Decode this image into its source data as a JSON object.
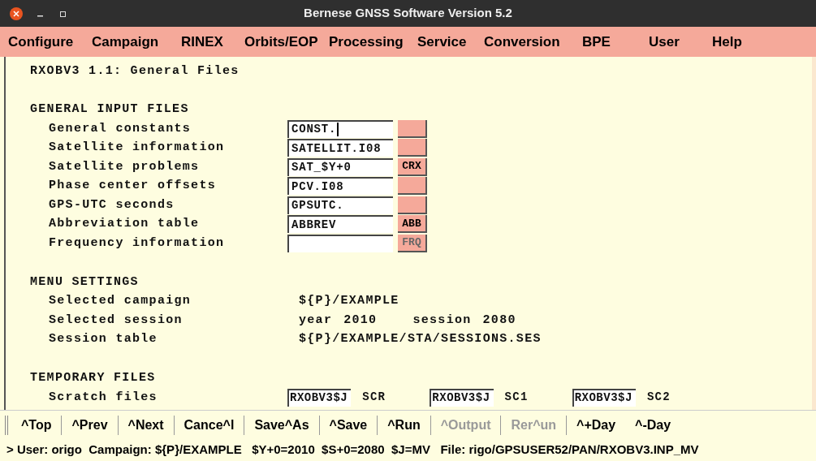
{
  "window": {
    "title": "Bernese GNSS Software Version 5.2"
  },
  "menu": [
    "Configure",
    "Campaign",
    "RINEX",
    "Orbits/EOP",
    "Processing",
    "Service",
    "Conversion",
    "BPE",
    "User",
    "Help"
  ],
  "panel_title": "RXOBV3 1.1: General Files",
  "sections": [
    {
      "heading": "GENERAL INPUT FILES",
      "rows": [
        {
          "kind": "file",
          "label": "General constants",
          "value": "CONST.",
          "focused": true
        },
        {
          "kind": "file",
          "label": "Satellite information",
          "value": "SATELLIT.I08",
          "focused": false
        },
        {
          "kind": "file",
          "label": "Satellite problems",
          "value": "SAT_$Y+0",
          "focused": false,
          "button": {
            "label": "CRX",
            "disabled": false
          }
        },
        {
          "kind": "file",
          "label": "Phase center offsets",
          "value": "PCV.I08",
          "focused": false
        },
        {
          "kind": "file",
          "label": "GPS-UTC seconds",
          "value": "GPSUTC.",
          "focused": false
        },
        {
          "kind": "file",
          "label": "Abbreviation table",
          "value": "ABBREV",
          "focused": false,
          "button": {
            "label": "ABB",
            "disabled": false
          }
        },
        {
          "kind": "file",
          "label": "Frequency information",
          "focused": false,
          "button": {
            "label": "FRQ",
            "disabled": true
          }
        }
      ]
    },
    {
      "heading": "MENU SETTINGS",
      "rows": [
        {
          "kind": "text",
          "label": "Selected campaign",
          "parts": [
            "${P}/EXAMPLE"
          ]
        },
        {
          "kind": "text",
          "label": "Selected session",
          "parts": [
            "year",
            "2010",
            "session",
            "2080"
          ]
        },
        {
          "kind": "text",
          "label": "Session table",
          "parts": [
            "${P}/EXAMPLE/STA/SESSIONS.SES"
          ]
        }
      ]
    },
    {
      "heading": "TEMPORARY FILES",
      "rows": [
        {
          "kind": "scratch",
          "label": "Scratch files",
          "items": [
            {
              "value": "RXOBV3$J",
              "ext": "SCR"
            },
            {
              "value": "RXOBV3$J",
              "ext": "SC1"
            },
            {
              "value": "RXOBV3$J",
              "ext": "SC2"
            }
          ]
        }
      ]
    }
  ],
  "toolbar": [
    {
      "label": "^Top",
      "disabled": false
    },
    {
      "label": "^Prev",
      "disabled": false
    },
    {
      "label": "^Next",
      "disabled": false
    },
    {
      "label": "Cance^l",
      "disabled": false
    },
    {
      "label": "Save^As",
      "disabled": false
    },
    {
      "label": "^Save",
      "disabled": false
    },
    {
      "label": "^Run",
      "disabled": false
    },
    {
      "label": "^Output",
      "disabled": true
    },
    {
      "label": "Rer^un",
      "disabled": true
    },
    {
      "label": "^+Day",
      "disabled": false
    },
    {
      "label": "^-Day",
      "disabled": false
    }
  ],
  "status_bar": "> User: origo  Campaign: ${P}/EXAMPLE   $Y+0=2010  $S+0=2080  $J=MV   File: rigo/GPSUSER52/PAN/RXOBV3.INP_MV"
}
